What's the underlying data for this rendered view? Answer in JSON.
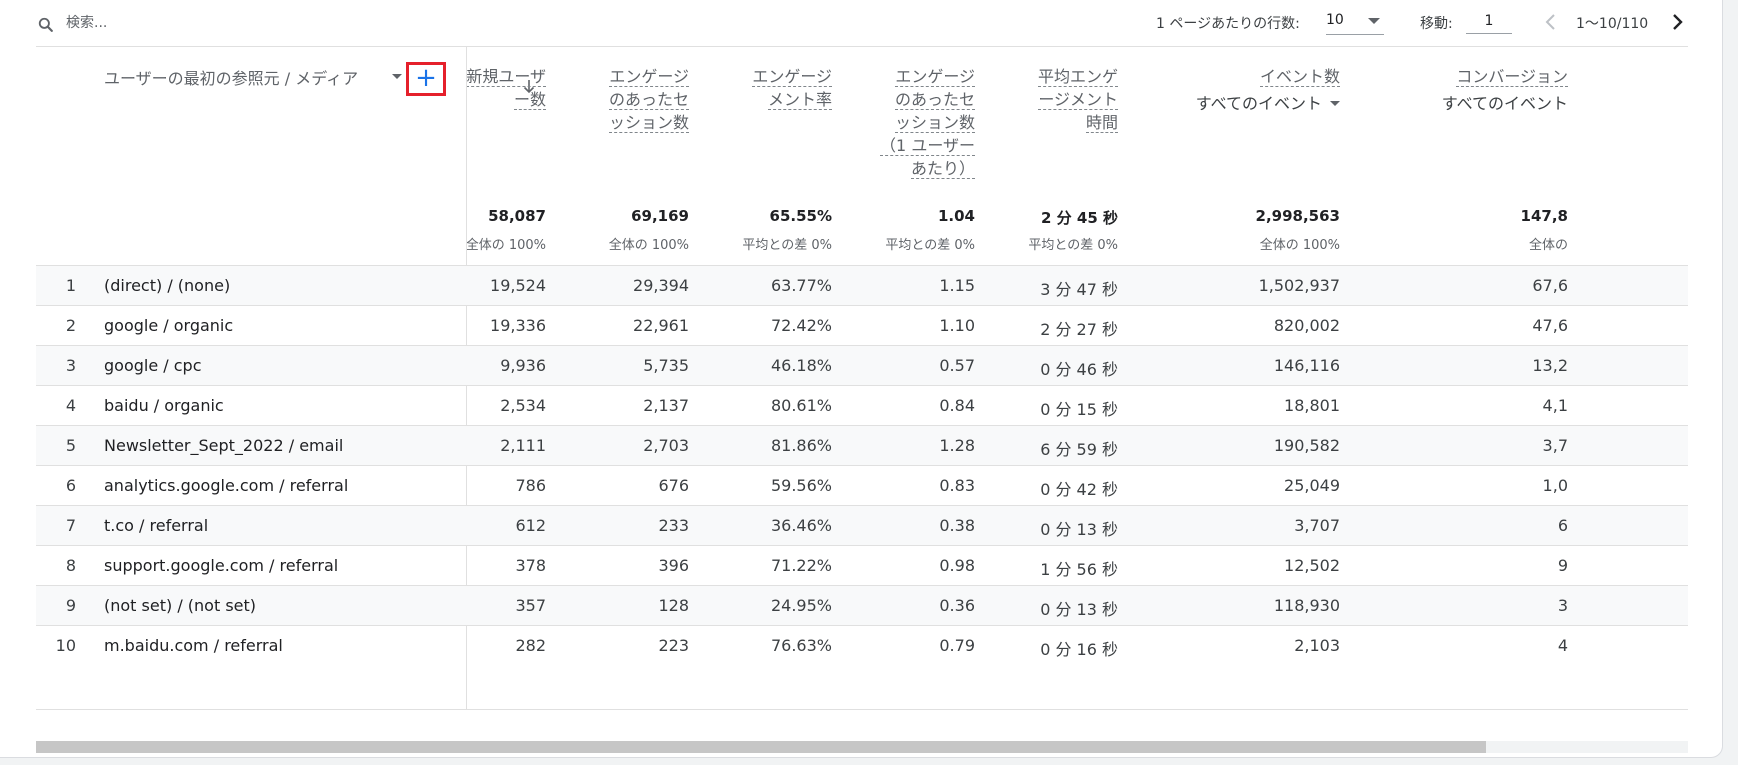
{
  "toolbar": {
    "search_placeholder": "検索...",
    "rows_per_page_label": "1 ページあたりの行数:",
    "rows_per_page_value": "10",
    "goto_label": "移動:",
    "goto_value": "1",
    "page_range": "1〜10/110"
  },
  "header": {
    "dimension_label": "ユーザーの最初の参照元 / メディア",
    "add_dimension_label": "+",
    "metrics": [
      {
        "label_lines": [
          "新規ユーザ",
          "ー数"
        ],
        "total": "58,087",
        "total_sub": "全体の 100%"
      },
      {
        "label_lines": [
          "エンゲージ",
          "のあったセ",
          "ッション数"
        ],
        "total": "69,169",
        "total_sub": "全体の 100%"
      },
      {
        "label_lines": [
          "エンゲージ",
          "メント率"
        ],
        "total": "65.55%",
        "total_sub": "平均との差 0%"
      },
      {
        "label_lines": [
          "エンゲージ",
          "のあったセ",
          "ッション数",
          "（1 ユーザー",
          "あたり）"
        ],
        "total": "1.04",
        "total_sub": "平均との差 0%"
      },
      {
        "label_lines": [
          "平均エンゲ",
          "ージメント",
          "時間"
        ],
        "total": "2 分 45 秒",
        "total_sub": "平均との差 0%"
      },
      {
        "label_lines": [
          "イベント数"
        ],
        "sub_select": "すべてのイベント",
        "total": "2,998,563",
        "total_sub": "全体の 100%"
      },
      {
        "label_lines": [
          "コンバージョン"
        ],
        "sub_select": "すべてのイベント",
        "total": "147,8",
        "total_sub": "全体の"
      }
    ]
  },
  "rows": [
    {
      "index": "1",
      "dimension": "(direct) / (none)",
      "values": [
        "19,524",
        "29,394",
        "63.77%",
        "1.15",
        "3 分 47 秒",
        "1,502,937",
        "67,6"
      ]
    },
    {
      "index": "2",
      "dimension": "google / organic",
      "values": [
        "19,336",
        "22,961",
        "72.42%",
        "1.10",
        "2 分 27 秒",
        "820,002",
        "47,6"
      ]
    },
    {
      "index": "3",
      "dimension": "google / cpc",
      "values": [
        "9,936",
        "5,735",
        "46.18%",
        "0.57",
        "0 分 46 秒",
        "146,116",
        "13,2"
      ]
    },
    {
      "index": "4",
      "dimension": "baidu / organic",
      "values": [
        "2,534",
        "2,137",
        "80.61%",
        "0.84",
        "0 分 15 秒",
        "18,801",
        "4,1"
      ]
    },
    {
      "index": "5",
      "dimension": "Newsletter_Sept_2022 / email",
      "values": [
        "2,111",
        "2,703",
        "81.86%",
        "1.28",
        "6 分 59 秒",
        "190,582",
        "3,7"
      ]
    },
    {
      "index": "6",
      "dimension": "analytics.google.com / referral",
      "values": [
        "786",
        "676",
        "59.56%",
        "0.83",
        "0 分 42 秒",
        "25,049",
        "1,0"
      ]
    },
    {
      "index": "7",
      "dimension": "t.co / referral",
      "values": [
        "612",
        "233",
        "36.46%",
        "0.38",
        "0 分 13 秒",
        "3,707",
        "6"
      ]
    },
    {
      "index": "8",
      "dimension": "support.google.com / referral",
      "values": [
        "378",
        "396",
        "71.22%",
        "0.98",
        "1 分 56 秒",
        "12,502",
        "9"
      ]
    },
    {
      "index": "9",
      "dimension": "(not set) / (not set)",
      "values": [
        "357",
        "128",
        "24.95%",
        "0.36",
        "0 分 13 秒",
        "118,930",
        "3"
      ]
    },
    {
      "index": "10",
      "dimension": "m.baidu.com / referral",
      "values": [
        "282",
        "223",
        "76.63%",
        "0.79",
        "0 分 16 秒",
        "2,103",
        "4"
      ]
    }
  ],
  "colors": {
    "accent": "#1a73e8",
    "highlight_box": "#e5202b",
    "row_alt": "#f8f9fa",
    "divider": "#e0e0e0"
  },
  "icons": [
    "search-icon",
    "chevron-down-icon",
    "arrow-down-icon",
    "chevron-left-icon",
    "chevron-right-icon",
    "plus-icon"
  ]
}
